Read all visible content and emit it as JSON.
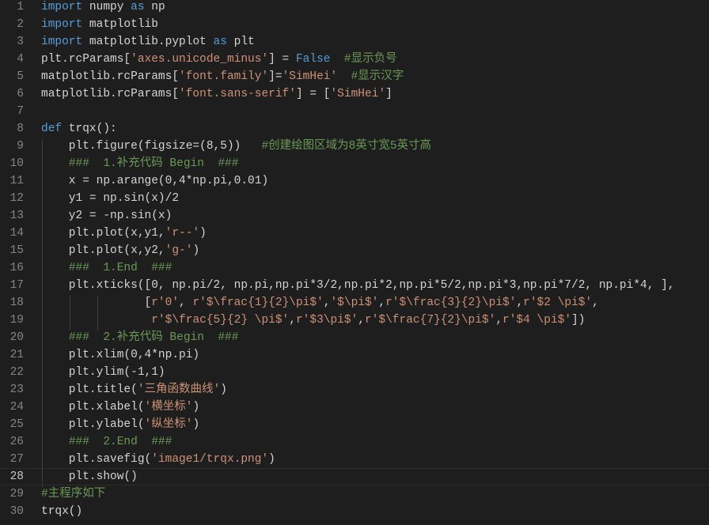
{
  "editor": {
    "current_line": 28,
    "lines": [
      {
        "n": "1",
        "t": [
          [
            "kw",
            "import"
          ],
          [
            "tx",
            " numpy "
          ],
          [
            "kw",
            "as"
          ],
          [
            "tx",
            " np"
          ]
        ]
      },
      {
        "n": "2",
        "t": [
          [
            "kw",
            "import"
          ],
          [
            "tx",
            " matplotlib"
          ]
        ]
      },
      {
        "n": "3",
        "t": [
          [
            "kw",
            "import"
          ],
          [
            "tx",
            " matplotlib.pyplot "
          ],
          [
            "kw",
            "as"
          ],
          [
            "tx",
            " plt"
          ]
        ]
      },
      {
        "n": "4",
        "t": [
          [
            "tx",
            "plt.rcParams["
          ],
          [
            "str",
            "'axes.unicode_minus'"
          ],
          [
            "tx",
            "] = "
          ],
          [
            "kw",
            "False"
          ],
          [
            "tx",
            "  "
          ],
          [
            "cm",
            "#显示负号"
          ]
        ]
      },
      {
        "n": "5",
        "t": [
          [
            "tx",
            "matplotlib.rcParams["
          ],
          [
            "str",
            "'font.family'"
          ],
          [
            "tx",
            "]="
          ],
          [
            "str",
            "'SimHei'"
          ],
          [
            "tx",
            "  "
          ],
          [
            "cm",
            "#显示汉字"
          ]
        ]
      },
      {
        "n": "6",
        "t": [
          [
            "tx",
            "matplotlib.rcParams["
          ],
          [
            "str",
            "'font.sans-serif'"
          ],
          [
            "tx",
            "] = ["
          ],
          [
            "str",
            "'SimHei'"
          ],
          [
            "tx",
            "]"
          ]
        ]
      },
      {
        "n": "7",
        "t": []
      },
      {
        "n": "8",
        "t": [
          [
            "kw",
            "def"
          ],
          [
            "tx",
            " trqx():"
          ]
        ]
      },
      {
        "n": "9",
        "t": [
          [
            "tx",
            "    plt.figure(figsize=(8,5))   "
          ],
          [
            "cm",
            "#创建绘图区域为8英寸宽5英寸高"
          ]
        ]
      },
      {
        "n": "10",
        "t": [
          [
            "tx",
            "    "
          ],
          [
            "cm",
            "###  1.补充代码 Begin  ###"
          ]
        ]
      },
      {
        "n": "11",
        "t": [
          [
            "tx",
            "    x = np.arange(0,4*np.pi,0.01)"
          ]
        ]
      },
      {
        "n": "12",
        "t": [
          [
            "tx",
            "    y1 = np.sin(x)/2"
          ]
        ]
      },
      {
        "n": "13",
        "t": [
          [
            "tx",
            "    y2 = -np.sin(x)"
          ]
        ]
      },
      {
        "n": "14",
        "t": [
          [
            "tx",
            "    plt.plot(x,y1,"
          ],
          [
            "str",
            "'r--'"
          ],
          [
            "tx",
            ")"
          ]
        ]
      },
      {
        "n": "15",
        "t": [
          [
            "tx",
            "    plt.plot(x,y2,"
          ],
          [
            "str",
            "'g-'"
          ],
          [
            "tx",
            ")"
          ]
        ]
      },
      {
        "n": "16",
        "t": [
          [
            "tx",
            "    "
          ],
          [
            "cm",
            "###  1.End  ###"
          ]
        ]
      },
      {
        "n": "17",
        "t": [
          [
            "tx",
            "    plt.xticks([0, np.pi/2, np.pi,np.pi*3/2,np.pi*2,np.pi*5/2,np.pi*3,np.pi*7/2, np.pi*4, ],"
          ]
        ]
      },
      {
        "n": "18",
        "t": [
          [
            "tx",
            "               ["
          ],
          [
            "str",
            "r'0'"
          ],
          [
            "tx",
            ", "
          ],
          [
            "str",
            "r'$\\frac{1}{2}\\pi$'"
          ],
          [
            "tx",
            ","
          ],
          [
            "str",
            "'$\\pi$'"
          ],
          [
            "tx",
            ","
          ],
          [
            "str",
            "r'$\\frac{3}{2}\\pi$'"
          ],
          [
            "tx",
            ","
          ],
          [
            "str",
            "r'$2 \\pi$'"
          ],
          [
            "tx",
            ","
          ]
        ]
      },
      {
        "n": "19",
        "t": [
          [
            "tx",
            "                "
          ],
          [
            "str",
            "r'$\\frac{5}{2} \\pi$'"
          ],
          [
            "tx",
            ","
          ],
          [
            "str",
            "r'$3\\pi$'"
          ],
          [
            "tx",
            ","
          ],
          [
            "str",
            "r'$\\frac{7}{2}\\pi$'"
          ],
          [
            "tx",
            ","
          ],
          [
            "str",
            "r'$4 \\pi$'"
          ],
          [
            "tx",
            "])"
          ]
        ]
      },
      {
        "n": "20",
        "t": [
          [
            "tx",
            "    "
          ],
          [
            "cm",
            "###  2.补充代码 Begin  ###"
          ]
        ]
      },
      {
        "n": "21",
        "t": [
          [
            "tx",
            "    plt.xlim(0,4*np.pi)"
          ]
        ]
      },
      {
        "n": "22",
        "t": [
          [
            "tx",
            "    plt.ylim(-1,1)"
          ]
        ]
      },
      {
        "n": "23",
        "t": [
          [
            "tx",
            "    plt.title("
          ],
          [
            "str",
            "'三角函数曲线'"
          ],
          [
            "tx",
            ")"
          ]
        ]
      },
      {
        "n": "24",
        "t": [
          [
            "tx",
            "    plt.xlabel("
          ],
          [
            "str",
            "'横坐标'"
          ],
          [
            "tx",
            ")"
          ]
        ]
      },
      {
        "n": "25",
        "t": [
          [
            "tx",
            "    plt.ylabel("
          ],
          [
            "str",
            "'纵坐标'"
          ],
          [
            "tx",
            ")"
          ]
        ]
      },
      {
        "n": "26",
        "t": [
          [
            "tx",
            "    "
          ],
          [
            "cm",
            "###  2.End  ###"
          ]
        ]
      },
      {
        "n": "27",
        "t": [
          [
            "tx",
            "    plt.savefig("
          ],
          [
            "str",
            "'image1/trqx.png'"
          ],
          [
            "tx",
            ")"
          ]
        ]
      },
      {
        "n": "28",
        "t": [
          [
            "tx",
            "    plt.show()"
          ]
        ]
      },
      {
        "n": "29",
        "t": [
          [
            "cm",
            "#主程序如下"
          ]
        ]
      },
      {
        "n": "30",
        "t": [
          [
            "tx",
            "trqx()"
          ]
        ]
      }
    ]
  }
}
